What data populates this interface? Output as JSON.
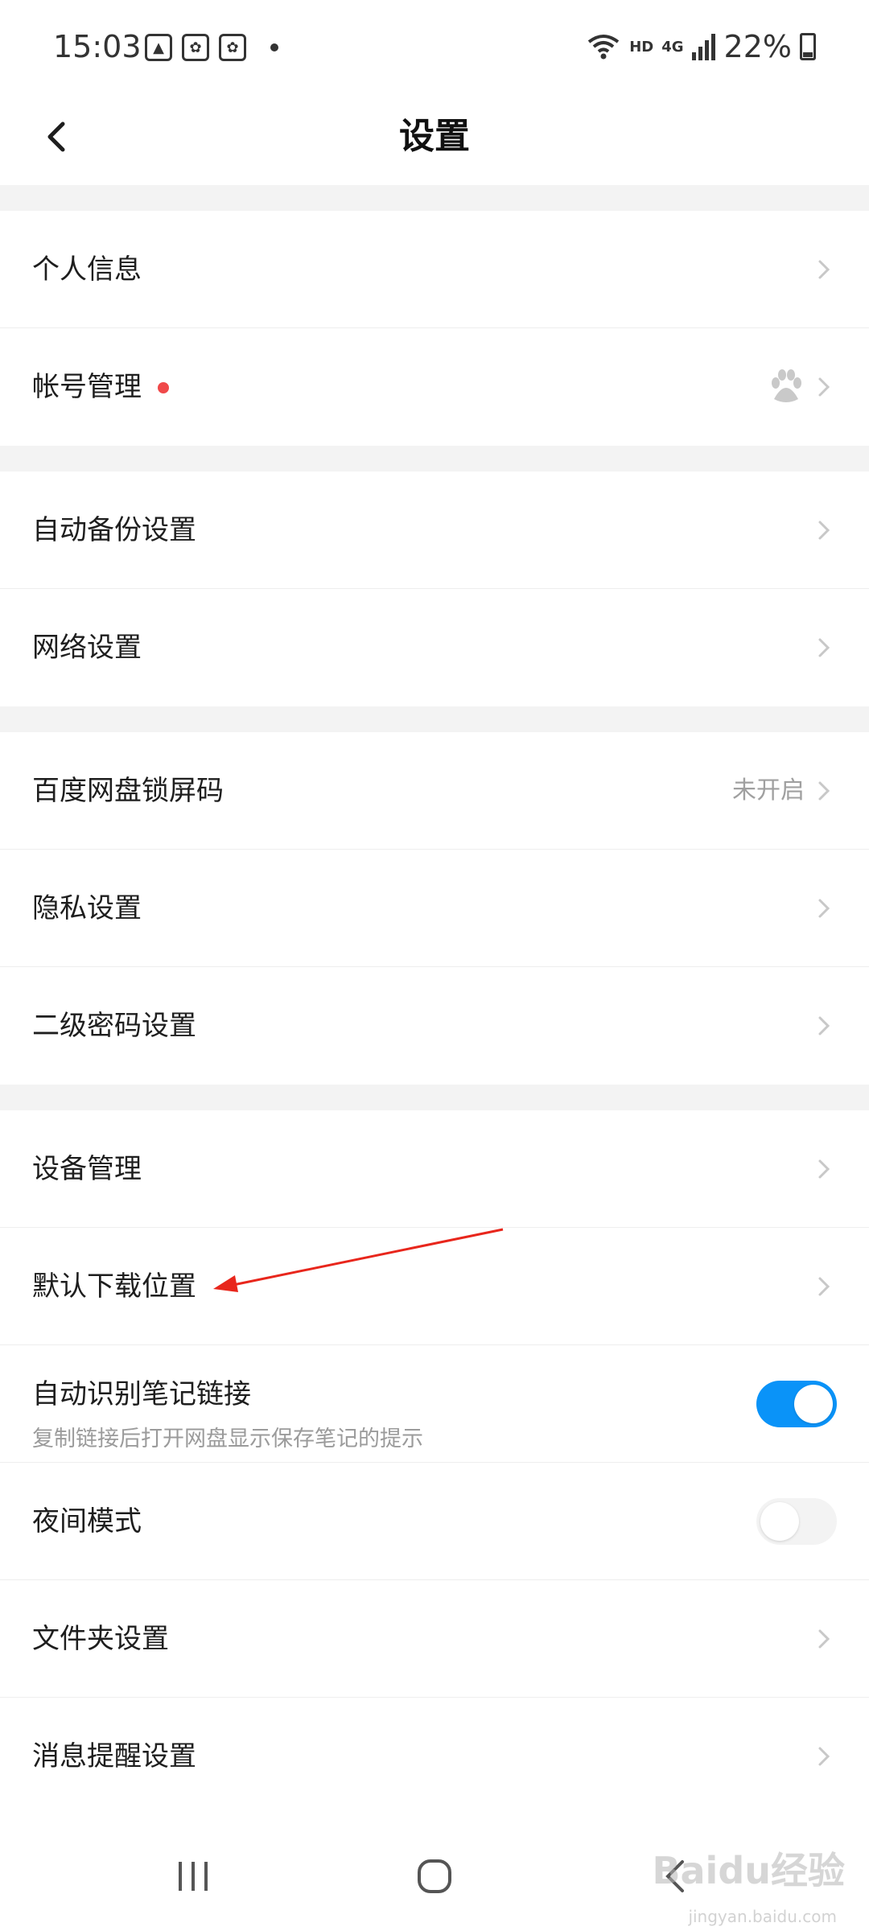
{
  "status_bar": {
    "time": "15:03",
    "network": "4G",
    "hd": "HD",
    "battery": "22%"
  },
  "header": {
    "title": "设置"
  },
  "sections": [
    {
      "rows": [
        {
          "label": "个人信息"
        },
        {
          "label": "帐号管理",
          "badge": "red-dot",
          "icon": "baidu-paw-icon"
        }
      ]
    },
    {
      "rows": [
        {
          "label": "自动备份设置"
        },
        {
          "label": "网络设置"
        }
      ]
    },
    {
      "rows": [
        {
          "label": "百度网盘锁屏码",
          "value": "未开启"
        },
        {
          "label": "隐私设置"
        },
        {
          "label": "二级密码设置"
        }
      ]
    },
    {
      "rows": [
        {
          "label": "设备管理"
        },
        {
          "label": "默认下载位置"
        },
        {
          "label": "自动识别笔记链接",
          "subtitle": "复制链接后打开网盘显示保存笔记的提示",
          "toggle": true
        },
        {
          "label": "夜间模式",
          "toggle": false
        },
        {
          "label": "文件夹设置"
        },
        {
          "label": "消息提醒设置"
        }
      ]
    }
  ],
  "colors": {
    "accent": "#0a93f8",
    "annotation_arrow": "#e8261c",
    "badge": "#f0494a"
  },
  "watermark": {
    "brand": "Baidu经验",
    "url": "jingyan.baidu.com"
  }
}
